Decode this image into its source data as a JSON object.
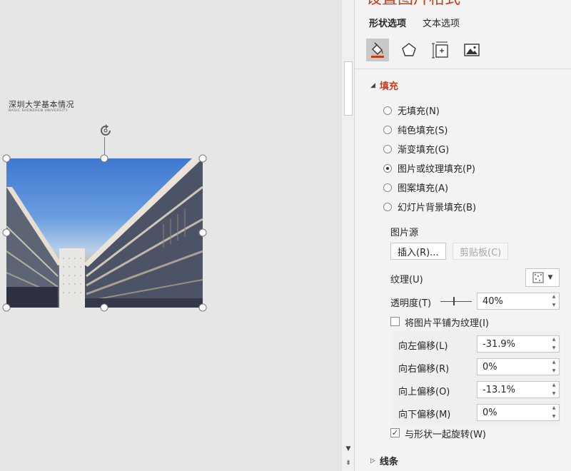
{
  "slide": {
    "title": "深圳大学基本情况",
    "subtitle": "BASIC SHENZHEN UNIVERSITY"
  },
  "pane": {
    "title": "设置图片格式",
    "tabs": [
      {
        "label": "形状选项",
        "active": true
      },
      {
        "label": "文本选项",
        "active": false
      }
    ],
    "category_icons": [
      "fill-line-icon",
      "effects-pentagon-icon",
      "size-properties-icon",
      "picture-icon"
    ]
  },
  "fill": {
    "header": "填充",
    "options": [
      {
        "label": "无填充(N)",
        "checked": false
      },
      {
        "label": "纯色填充(S)",
        "checked": false
      },
      {
        "label": "渐变填充(G)",
        "checked": false
      },
      {
        "label": "图片或纹理填充(P)",
        "checked": true
      },
      {
        "label": "图案填充(A)",
        "checked": false
      },
      {
        "label": "幻灯片背景填充(B)",
        "checked": false
      }
    ],
    "picture_source_label": "图片源",
    "insert_button": "插入(R)...",
    "clipboard_button": "剪贴板(C)",
    "texture_label": "纹理(U)",
    "transparency_label": "透明度(T)",
    "transparency_value": "40%",
    "tile_checkbox_label": "将图片平铺为纹理(I)",
    "tile_checked": false,
    "offsets": [
      {
        "label": "向左偏移(L)",
        "value": "-31.9%"
      },
      {
        "label": "向右偏移(R)",
        "value": "0%"
      },
      {
        "label": "向上偏移(O)",
        "value": "-13.1%"
      },
      {
        "label": "向下偏移(M)",
        "value": "0%"
      }
    ],
    "rotate_checkbox_label": "与形状一起旋转(W)",
    "rotate_checked": true
  },
  "line": {
    "header": "线条"
  },
  "colors": {
    "accent": "#c43e1c",
    "pane_bg": "#f3f3f3",
    "canvas_bg": "#e6e6e6"
  }
}
